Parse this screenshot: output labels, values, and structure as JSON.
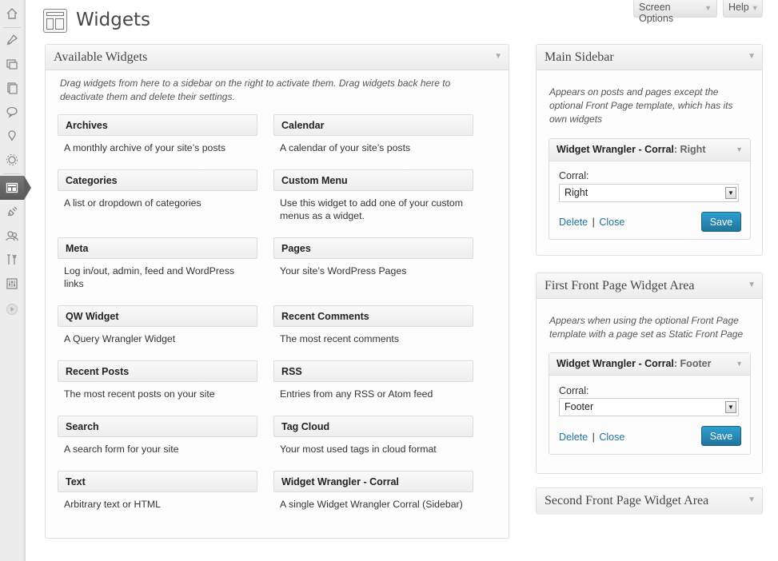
{
  "header": {
    "title": "Widgets",
    "screen_options_label": "Screen Options",
    "help_label": "Help"
  },
  "admin_menu": [
    {
      "icon": "dashboard-icon"
    },
    {
      "icon": "posts-icon"
    },
    {
      "icon": "media-icon"
    },
    {
      "icon": "pages-icon"
    },
    {
      "icon": "comments-icon"
    },
    {
      "icon": "feedback-icon"
    },
    {
      "icon": "settings-icon"
    },
    {
      "icon": "appearance-icon",
      "active": true
    },
    {
      "icon": "plugins-icon"
    },
    {
      "icon": "users-icon"
    },
    {
      "icon": "tools-icon"
    },
    {
      "icon": "settings-sliders-icon"
    },
    {
      "icon": "collapse-menu-icon"
    }
  ],
  "available": {
    "title": "Available Widgets",
    "description": "Drag widgets from here to a sidebar on the right to activate them. Drag widgets back here to deactivate them and delete their settings.",
    "widgets": [
      {
        "title": "Archives",
        "desc": "A monthly archive of your site’s posts"
      },
      {
        "title": "Calendar",
        "desc": "A calendar of your site’s posts"
      },
      {
        "title": "Categories",
        "desc": "A list or dropdown of categories"
      },
      {
        "title": "Custom Menu",
        "desc": "Use this widget to add one of your custom menus as a widget."
      },
      {
        "title": "Meta",
        "desc": "Log in/out, admin, feed and WordPress links"
      },
      {
        "title": "Pages",
        "desc": "Your site’s WordPress Pages"
      },
      {
        "title": "QW Widget",
        "desc": "A Query Wrangler Widget"
      },
      {
        "title": "Recent Comments",
        "desc": "The most recent comments"
      },
      {
        "title": "Recent Posts",
        "desc": "The most recent posts on your site"
      },
      {
        "title": "RSS",
        "desc": "Entries from any RSS or Atom feed"
      },
      {
        "title": "Search",
        "desc": "A search form for your site"
      },
      {
        "title": "Tag Cloud",
        "desc": "Your most used tags in cloud format"
      },
      {
        "title": "Text",
        "desc": "Arbitrary text or HTML"
      },
      {
        "title": "Widget Wrangler - Corral",
        "desc": "A single Widget Wrangler Corral (Sidebar)"
      }
    ]
  },
  "main_sidebar": {
    "title": "Main Sidebar",
    "description": "Appears on posts and pages except the optional Front Page template, which has its own widgets",
    "widget": {
      "name": "Widget Wrangler - Corral",
      "sep": ": ",
      "subtitle": "Right",
      "field_label": "Corral:",
      "field_value": "Right",
      "delete_label": "Delete",
      "link_sep": "|",
      "close_label": "Close",
      "save_label": "Save"
    }
  },
  "first_front": {
    "title": "First Front Page Widget Area",
    "description": "Appears when using the optional Front Page template with a page set as Static Front Page",
    "widget": {
      "name": "Widget Wrangler - Corral",
      "sep": ": ",
      "subtitle": "Footer",
      "field_label": "Corral:",
      "field_value": "Footer",
      "delete_label": "Delete",
      "link_sep": "|",
      "close_label": "Close",
      "save_label": "Save"
    }
  },
  "second_front": {
    "title": "Second Front Page Widget Area"
  },
  "glyphs": {
    "toggle": "▼",
    "dropdown": "▼"
  }
}
